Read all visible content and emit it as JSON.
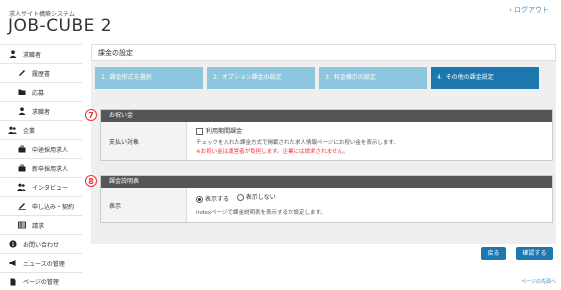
{
  "brand": {
    "subtitle": "求人サイト構築システム",
    "title": "JOB-CUBE 2"
  },
  "header": {
    "logout_label": "ログアウト"
  },
  "sidebar": {
    "items": [
      {
        "label": "求職者",
        "icon": "user-icon",
        "level": "top"
      },
      {
        "label": "履歴書",
        "icon": "pen-icon",
        "level": "sub"
      },
      {
        "label": "応募",
        "icon": "folder-icon",
        "level": "sub"
      },
      {
        "label": "求職者",
        "icon": "user-icon",
        "level": "sub"
      },
      {
        "label": "企業",
        "icon": "users-icon",
        "level": "top"
      },
      {
        "label": "中途採用求人",
        "icon": "briefcase-icon",
        "level": "sub"
      },
      {
        "label": "新卒採用求人",
        "icon": "briefcase-icon",
        "level": "sub"
      },
      {
        "label": "インタビュー",
        "icon": "users-icon",
        "level": "sub"
      },
      {
        "label": "申し込み・契約",
        "icon": "edit-icon",
        "level": "sub"
      },
      {
        "label": "請求",
        "icon": "table-icon",
        "level": "sub"
      },
      {
        "label": "お問い合わせ",
        "icon": "info-icon",
        "level": "top"
      },
      {
        "label": "ニュースの管理",
        "icon": "bullhorn-icon",
        "level": "top"
      },
      {
        "label": "ページの管理",
        "icon": "file-icon",
        "level": "top"
      }
    ]
  },
  "main": {
    "title": "課金の設定",
    "steps": [
      {
        "num": "1.",
        "label": "課金形式を選択",
        "active": false
      },
      {
        "num": "2.",
        "label": "オプション課金の設定",
        "active": false
      },
      {
        "num": "3.",
        "label": "料金横示の設定",
        "active": false
      },
      {
        "num": "4.",
        "label": "その他の課金設定",
        "active": true
      }
    ],
    "section1": {
      "marker": "7",
      "heading": "お祝い金",
      "row_label": "支払い対象",
      "checkbox_label": "利用期間課金",
      "desc": "チェックを入れた課金方式で掲載された求人情報ページにお祝い金を表示します。",
      "warning": "※お祝い金は運営者が負担します。企業には請求されません。"
    },
    "section2": {
      "marker": "8",
      "heading": "課金説明表",
      "row_label": "表示",
      "radio_show": "表示する",
      "radio_hide": "表示しない",
      "desc": "indexページで課金説明表を表示するか設定します。"
    },
    "buttons": {
      "back": "戻る",
      "confirm": "確認する"
    },
    "to_top": "ページの先頭へ"
  }
}
